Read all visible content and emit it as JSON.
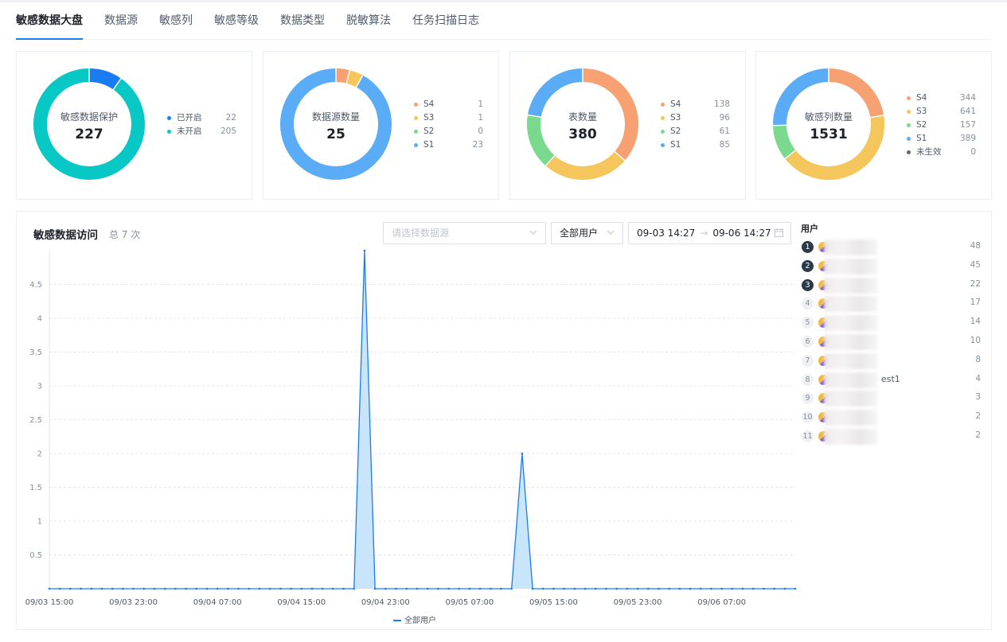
{
  "tabs": [
    "敏感数据大盘",
    "数据源",
    "敏感列",
    "敏感等级",
    "数据类型",
    "脱敏算法",
    "任务扫描日志"
  ],
  "active_tab": 0,
  "colors": {
    "S4": "#f7a072",
    "S3": "#f4c65c",
    "S2": "#79d98d",
    "S1": "#5aacf7",
    "inactive": "#666666",
    "on": "#1a7cf2",
    "off": "#08c8c6",
    "accent": "#1a7cf2"
  },
  "cards": [
    {
      "title": "敏感数据保护",
      "value": "227",
      "legend": [
        {
          "label": "已开启",
          "value": "22",
          "color": "#1a7cf2"
        },
        {
          "label": "未开启",
          "value": "205",
          "color": "#08c8c6"
        }
      ]
    },
    {
      "title": "数据源数量",
      "value": "25",
      "legend": [
        {
          "label": "S4",
          "value": "1",
          "color": "#f7a072"
        },
        {
          "label": "S3",
          "value": "1",
          "color": "#f4c65c"
        },
        {
          "label": "S2",
          "value": "0",
          "color": "#79d98d"
        },
        {
          "label": "S1",
          "value": "23",
          "color": "#5aacf7"
        }
      ]
    },
    {
      "title": "表数量",
      "value": "380",
      "legend": [
        {
          "label": "S4",
          "value": "138",
          "color": "#f7a072"
        },
        {
          "label": "S3",
          "value": "96",
          "color": "#f4c65c"
        },
        {
          "label": "S2",
          "value": "61",
          "color": "#79d98d"
        },
        {
          "label": "S1",
          "value": "85",
          "color": "#5aacf7"
        }
      ]
    },
    {
      "title": "敏感列数量",
      "value": "1531",
      "legend": [
        {
          "label": "S4",
          "value": "344",
          "color": "#f7a072"
        },
        {
          "label": "S3",
          "value": "641",
          "color": "#f4c65c"
        },
        {
          "label": "S2",
          "value": "157",
          "color": "#79d98d"
        },
        {
          "label": "S1",
          "value": "389",
          "color": "#5aacf7"
        },
        {
          "label": "未生效",
          "value": "0",
          "color": "#666666"
        }
      ]
    }
  ],
  "access": {
    "title": "敏感数据访问",
    "total": "总 7 次",
    "datasource_placeholder": "请选择数据源",
    "user_select": "全部用户",
    "date_start": "09-03 14:27",
    "date_end": "09-06 14:27",
    "range_sep": "→",
    "users_title": "用户",
    "users": [
      {
        "rank": "1",
        "name": "",
        "count": "48"
      },
      {
        "rank": "2",
        "name": "",
        "count": "45"
      },
      {
        "rank": "3",
        "name": "",
        "count": "22"
      },
      {
        "rank": "4",
        "name": "",
        "count": "17"
      },
      {
        "rank": "5",
        "name": "",
        "count": "14"
      },
      {
        "rank": "6",
        "name": "",
        "count": "10"
      },
      {
        "rank": "7",
        "name": "",
        "count": "8"
      },
      {
        "rank": "8",
        "name": "est1",
        "count": "4"
      },
      {
        "rank": "9",
        "name": "",
        "count": "3"
      },
      {
        "rank": "10",
        "name": "",
        "count": "2"
      },
      {
        "rank": "11",
        "name": "",
        "count": "2"
      }
    ]
  },
  "chart_data": {
    "type": "area",
    "series": [
      {
        "name": "全部用户",
        "values": [
          0,
          0,
          0,
          0,
          0,
          0,
          0,
          0,
          0,
          0,
          0,
          0,
          0,
          0,
          0,
          0,
          0,
          0,
          0,
          0,
          0,
          0,
          0,
          0,
          0,
          0,
          0,
          0,
          0,
          0,
          5,
          0,
          0,
          0,
          0,
          0,
          0,
          0,
          0,
          0,
          0,
          0,
          0,
          0,
          0,
          2,
          0,
          0,
          0,
          0,
          0,
          0,
          0,
          0,
          0,
          0,
          0,
          0,
          0,
          0,
          0,
          0,
          0,
          0,
          0,
          0,
          0,
          0,
          0,
          0,
          0,
          0
        ]
      }
    ],
    "x_ticks": [
      "09/03 15:00",
      "09/03 23:00",
      "09/04 07:00",
      "09/04 15:00",
      "09/04 23:00",
      "09/05 07:00",
      "09/05 15:00",
      "09/05 23:00",
      "09/06 07:00"
    ],
    "x_tick_step": 8,
    "y_ticks": [
      "0.5",
      "1",
      "1.5",
      "2",
      "2.5",
      "3",
      "3.5",
      "4",
      "4.5"
    ],
    "ylim": [
      0,
      5
    ],
    "grid": true,
    "legend_position": "bottom"
  }
}
